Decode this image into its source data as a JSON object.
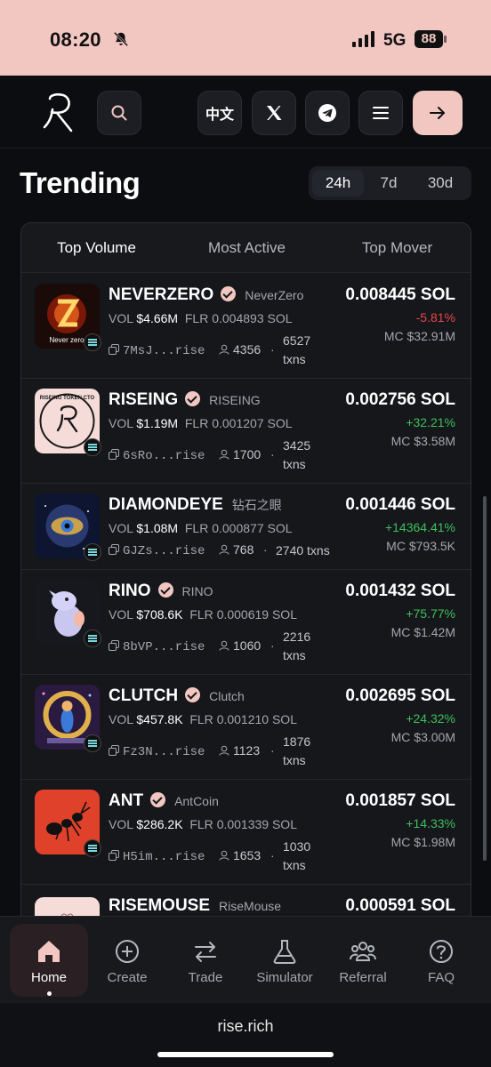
{
  "status_bar": {
    "time": "08:20",
    "network": "5G",
    "battery": "88"
  },
  "header": {
    "lang_label": "中文"
  },
  "trending": {
    "title": "Trending",
    "time_tabs": [
      "24h",
      "7d",
      "30d"
    ],
    "categories": [
      "Top Volume",
      "Most Active",
      "Top Mover"
    ]
  },
  "tokens": [
    {
      "name": "NEVERZERO",
      "ticker": "NeverZero",
      "verified": true,
      "vol": "$4.66M",
      "flr": "0.004893 SOL",
      "addr": "7MsJ...rise",
      "holders": "4356",
      "txns_num": "6527",
      "txns_word": "txns",
      "price": "0.008445 SOL",
      "change": "-5.81%",
      "mc": "MC $32.91M",
      "thumb_caption": "Never zero"
    },
    {
      "name": "RISEING",
      "ticker": "RISEING",
      "verified": true,
      "vol": "$1.19M",
      "flr": "0.001207 SOL",
      "addr": "6sRo...rise",
      "holders": "1700",
      "txns_num": "3425",
      "txns_word": "txns",
      "price": "0.002756 SOL",
      "change": "+32.21%",
      "mc": "MC $3.58M",
      "thumb_caption": "RISEING TOKEN CTO"
    },
    {
      "name": "DIAMONDEYE",
      "ticker": "钻石之眼",
      "verified": false,
      "vol": "$1.08M",
      "flr": "0.000877 SOL",
      "addr": "GJZs...rise",
      "holders": "768",
      "txns_num": "2740 txns",
      "txns_word": "",
      "price": "0.001446 SOL",
      "change": "+14364.41%",
      "mc": "MC $793.5K"
    },
    {
      "name": "RINO",
      "ticker": "RINO",
      "verified": true,
      "vol": "$708.6K",
      "flr": "0.000619 SOL",
      "addr": "8bVP...rise",
      "holders": "1060",
      "txns_num": "2216",
      "txns_word": "txns",
      "price": "0.001432 SOL",
      "change": "+75.77%",
      "mc": "MC $1.42M"
    },
    {
      "name": "CLUTCH",
      "ticker": "Clutch",
      "verified": true,
      "vol": "$457.8K",
      "flr": "0.001210 SOL",
      "addr": "Fz3N...rise",
      "holders": "1123",
      "txns_num": "1876",
      "txns_word": "txns",
      "price": "0.002695 SOL",
      "change": "+24.32%",
      "mc": "MC $3.00M"
    },
    {
      "name": "ANT",
      "ticker": "AntCoin",
      "verified": true,
      "vol": "$286.2K",
      "flr": "0.001339 SOL",
      "addr": "H5im...rise",
      "holders": "1653",
      "txns_num": "1030",
      "txns_word": "txns",
      "price": "0.001857 SOL",
      "change": "+14.33%",
      "mc": "MC $1.98M"
    },
    {
      "name": "RISEMOUSE",
      "ticker": "RiseMouse",
      "verified": false,
      "price": "0.000591 SOL"
    }
  ],
  "labels": {
    "vol": "VOL",
    "flr": "FLR"
  },
  "nav": [
    {
      "label": "Home",
      "icon": "home-icon"
    },
    {
      "label": "Create",
      "icon": "plus-circle-icon"
    },
    {
      "label": "Trade",
      "icon": "swap-arrows-icon"
    },
    {
      "label": "Simulator",
      "icon": "flask-icon"
    },
    {
      "label": "Referral",
      "icon": "people-icon"
    },
    {
      "label": "FAQ",
      "icon": "question-icon"
    }
  ],
  "browser": {
    "url": "rise.rich"
  },
  "colors": {
    "accent": "#f2c7c2",
    "up": "#3fbf5c",
    "down": "#e5484d",
    "bg": "#0c0d10"
  }
}
